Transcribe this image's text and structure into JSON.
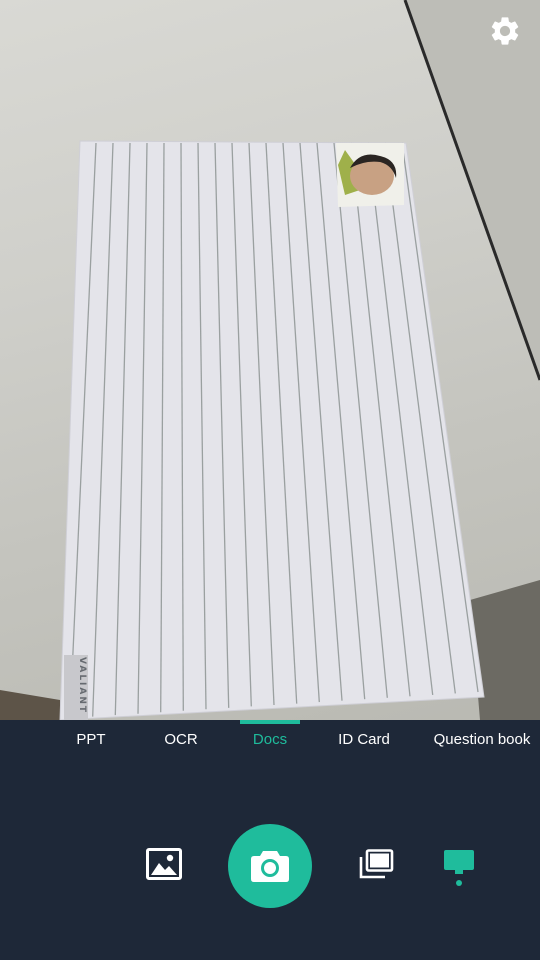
{
  "colors": {
    "accent": "#1fbc9c",
    "panel_background": "#1e2838",
    "tab_text": "#ffffff"
  },
  "viewfinder": {
    "document_brand_text": "VALIANT"
  },
  "top_bar": {
    "settings_icon": "gear-icon"
  },
  "mode_tabs": [
    {
      "label": "PPT",
      "active": false
    },
    {
      "label": "OCR",
      "active": false
    },
    {
      "label": "Docs",
      "active": true
    },
    {
      "label": "ID Card",
      "active": false
    },
    {
      "label": "Question book",
      "active": false
    }
  ],
  "controls": {
    "gallery_icon": "image-gallery-icon",
    "shutter_icon": "camera-icon",
    "batch_icon": "stacked-pages-icon",
    "single_mode_icon": "single-page-icon"
  }
}
